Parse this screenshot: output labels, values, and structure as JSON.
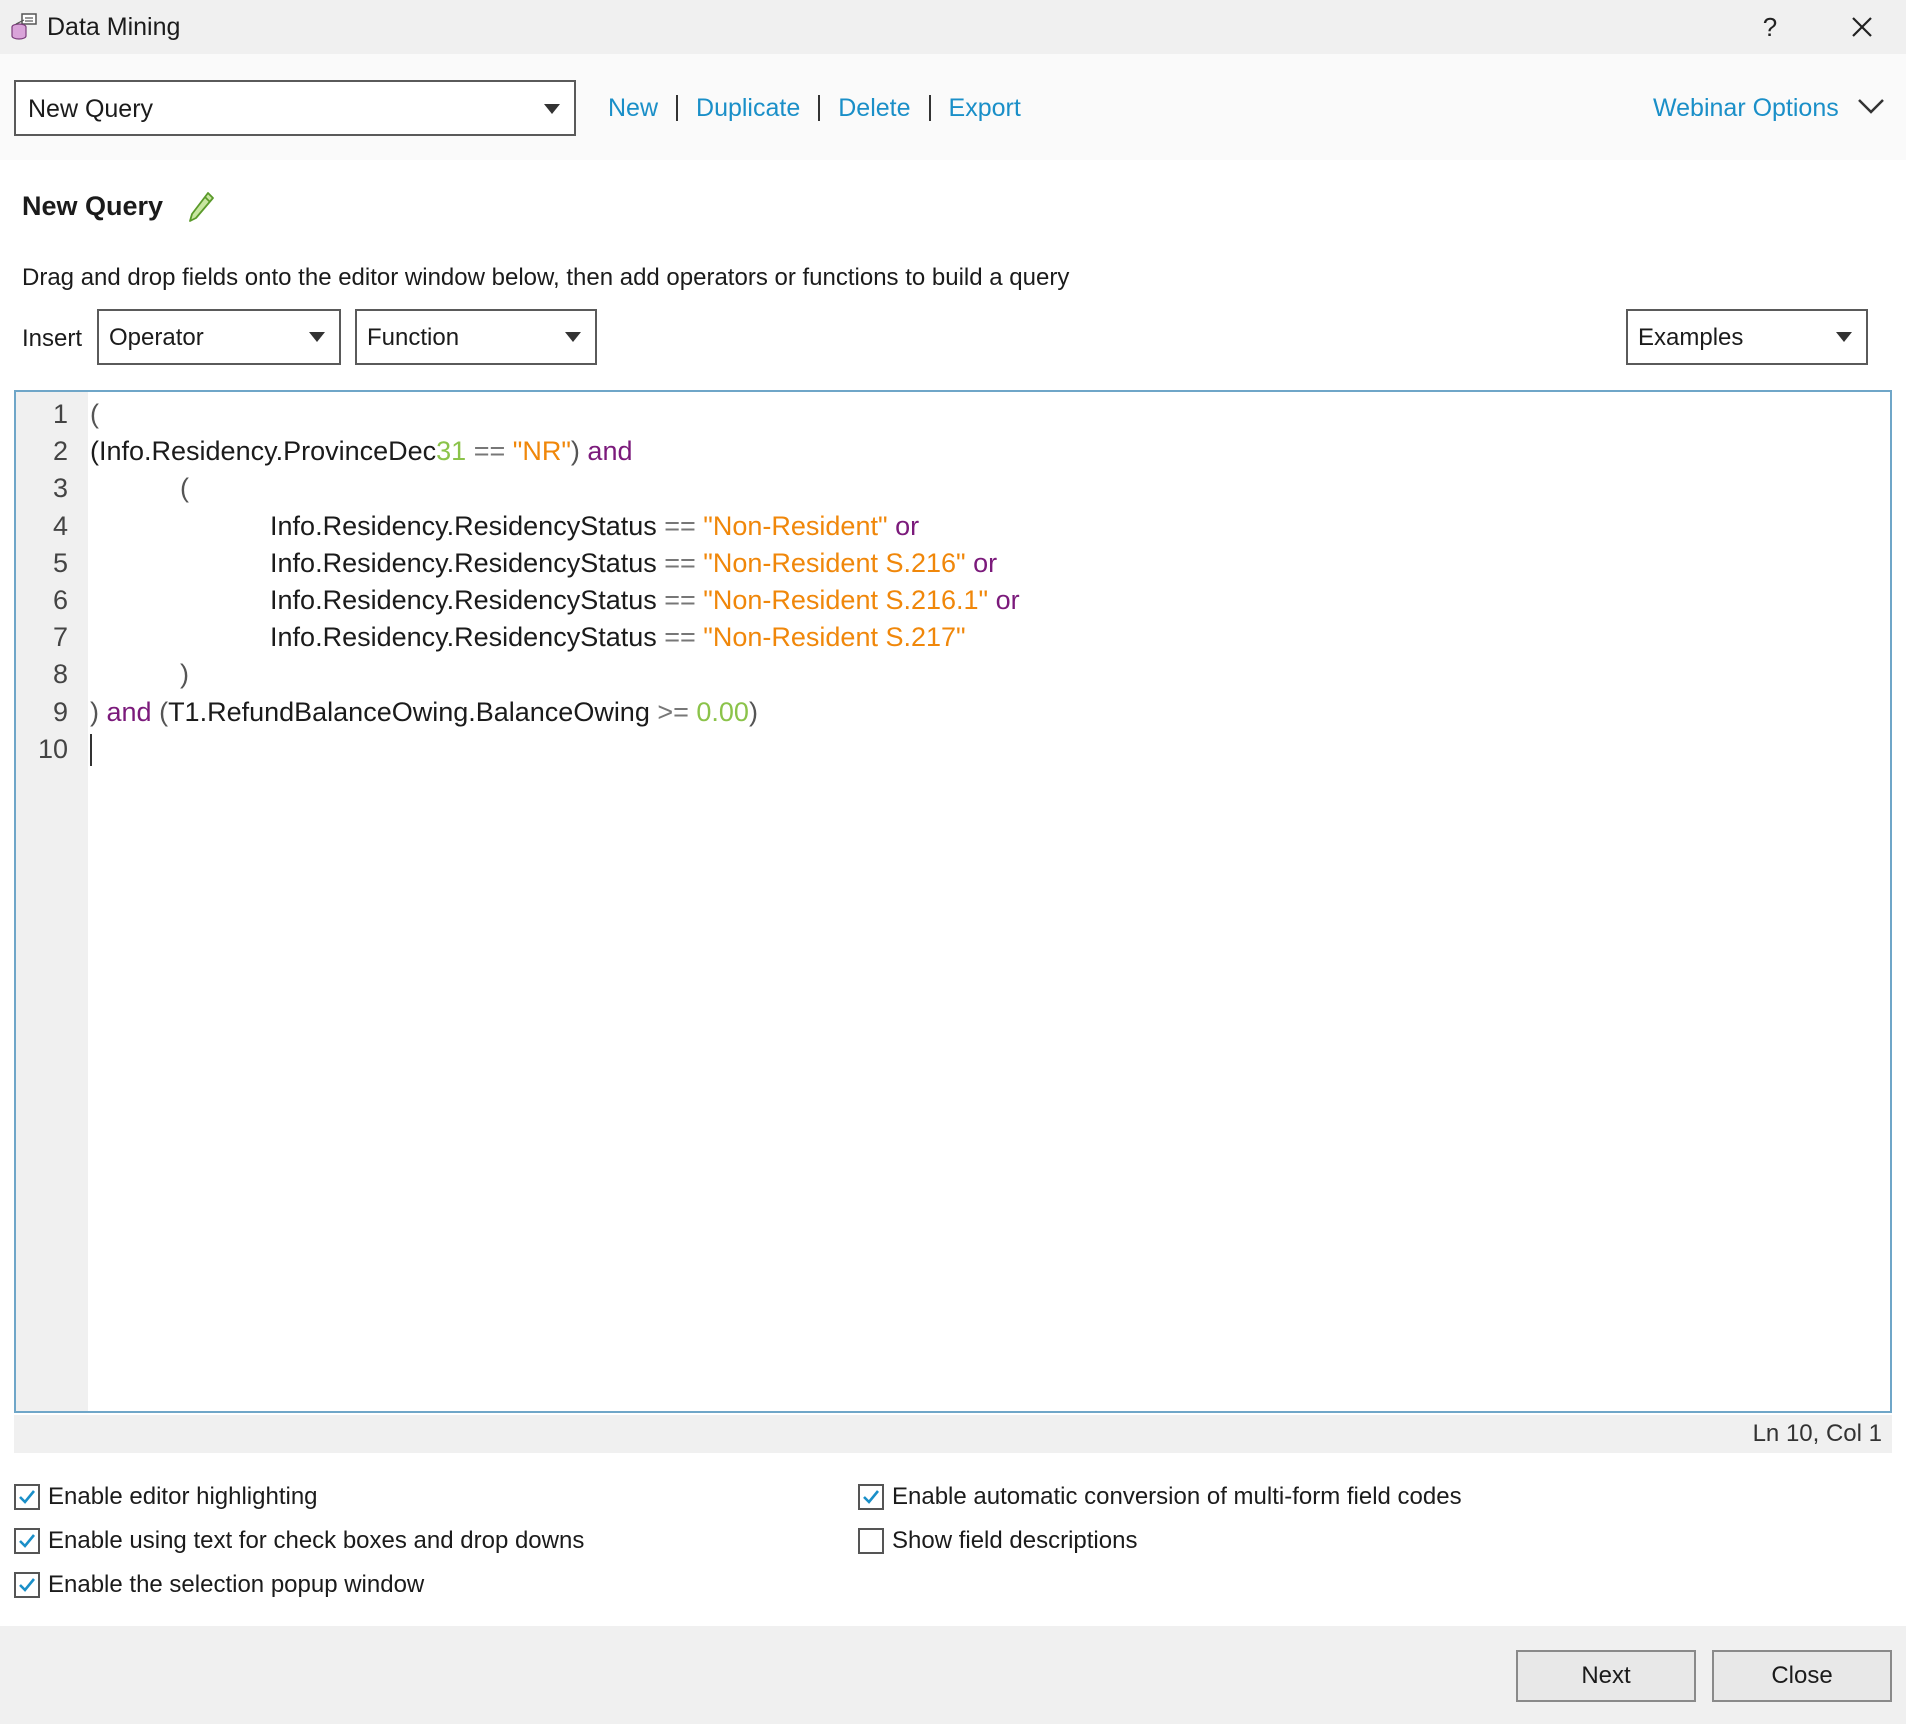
{
  "window": {
    "title": "Data Mining",
    "help_label": "?",
    "app_icon": "data-mining-icon",
    "close_icon": "close-icon"
  },
  "toolbar": {
    "query_selected": "New Query",
    "links": [
      "New",
      "Duplicate",
      "Delete",
      "Export"
    ],
    "webinar_label": "Webinar Options",
    "expand_icon": "chevron-down-icon"
  },
  "query": {
    "name": "New Query",
    "edit_icon": "pencil-icon",
    "instructions": "Drag and drop fields onto the editor window below, then add operators or functions to build a query"
  },
  "insert": {
    "label": "Insert",
    "operator": "Operator",
    "function": "Function",
    "examples": "Examples"
  },
  "editor": {
    "line_numbers": [
      "1",
      "2",
      "3",
      "4",
      "5",
      "6",
      "7",
      "8",
      "9",
      "10"
    ],
    "lines": [
      [
        {
          "t": "(",
          "k": "paren"
        }
      ],
      [
        {
          "t": "(Info.Residency.ProvinceDec",
          "k": "id"
        },
        {
          "t": "31",
          "k": "num"
        },
        {
          "t": " == ",
          "k": "op"
        },
        {
          "t": "\"NR\"",
          "k": "str"
        },
        {
          "t": ") ",
          "k": "paren"
        },
        {
          "t": "and",
          "k": "kw"
        }
      ],
      [
        {
          "t": "            (",
          "k": "paren"
        }
      ],
      [
        {
          "t": "                        Info.Residency.ResidencyStatus",
          "k": "id"
        },
        {
          "t": " == ",
          "k": "op"
        },
        {
          "t": "\"Non-Resident\"",
          "k": "str"
        },
        {
          "t": " or",
          "k": "kw"
        }
      ],
      [
        {
          "t": "                        Info.Residency.ResidencyStatus",
          "k": "id"
        },
        {
          "t": " == ",
          "k": "op"
        },
        {
          "t": "\"Non-Resident S.216\"",
          "k": "str"
        },
        {
          "t": " or",
          "k": "kw"
        }
      ],
      [
        {
          "t": "                        Info.Residency.ResidencyStatus",
          "k": "id"
        },
        {
          "t": " == ",
          "k": "op"
        },
        {
          "t": "\"Non-Resident S.216.1\"",
          "k": "str"
        },
        {
          "t": " or",
          "k": "kw"
        }
      ],
      [
        {
          "t": "                        Info.Residency.ResidencyStatus",
          "k": "id"
        },
        {
          "t": " == ",
          "k": "op"
        },
        {
          "t": "\"Non-Resident S.217\"",
          "k": "str"
        }
      ],
      [
        {
          "t": "            )",
          "k": "paren"
        }
      ],
      [
        {
          "t": ") ",
          "k": "paren"
        },
        {
          "t": "and",
          "k": "kw"
        },
        {
          "t": " (",
          "k": "paren"
        },
        {
          "t": "T1.RefundBalanceOwing.BalanceOwing",
          "k": "id"
        },
        {
          "t": " >= ",
          "k": "op"
        },
        {
          "t": "0.00",
          "k": "num"
        },
        {
          "t": ")",
          "k": "paren"
        }
      ],
      [
        {
          "t": "",
          "k": "id"
        }
      ]
    ],
    "status": "Ln 10, Col 1"
  },
  "options": {
    "highlighting": {
      "label": "Enable editor highlighting",
      "checked": true
    },
    "text_checkboxes": {
      "label": "Enable using text for check boxes and drop downs",
      "checked": true
    },
    "selection_popup": {
      "label": "Enable the selection popup window",
      "checked": true
    },
    "auto_conversion": {
      "label": "Enable automatic conversion of multi-form field codes",
      "checked": true
    },
    "field_descriptions": {
      "label": "Show field descriptions",
      "checked": false
    }
  },
  "footer": {
    "next_label": "Next",
    "close_label": "Close"
  },
  "colors": {
    "link": "#1a8fc8",
    "string": "#f0870a",
    "number": "#8bc34a",
    "keyword": "#7b1a7b",
    "editor_border": "#6fa6c8"
  }
}
